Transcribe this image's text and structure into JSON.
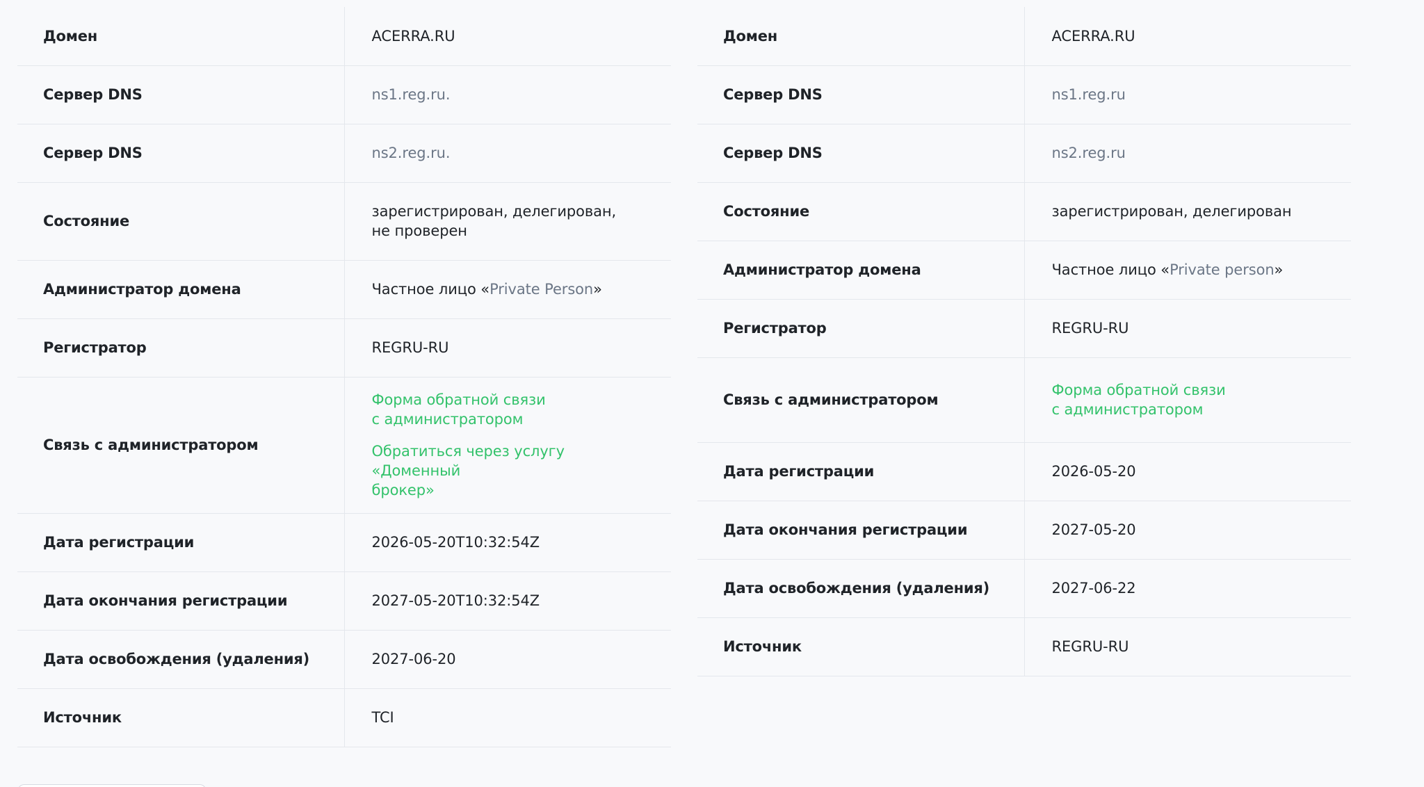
{
  "left": {
    "rows": [
      {
        "key": "Домен",
        "value": "ACERRA.RU"
      },
      {
        "key": "Сервер DNS",
        "value": "ns1.reg.ru."
      },
      {
        "key": "Сервер DNS",
        "value": "ns2.reg.ru."
      },
      {
        "key": "Состояние",
        "value": "зарегистрирован, делегирован,\nне проверен"
      },
      {
        "key": "Администратор домена",
        "value_prefix": "Частное лицо «",
        "value_link": "Private Person",
        "value_suffix": "»"
      },
      {
        "key": "Регистратор",
        "value": "REGRU-RU"
      },
      {
        "key": "Связь с администратором",
        "link1": "Форма обратной связи\nс администратором",
        "link2": "Обратиться через услугу «Доменный\nброкер»"
      },
      {
        "key": "Дата регистрации",
        "value": "2026-05-20T10:32:54Z"
      },
      {
        "key": "Дата окончания регистрации",
        "value": "2027-05-20T10:32:54Z"
      },
      {
        "key": "Дата освобождения (удаления)",
        "value": "2027-06-20"
      },
      {
        "key": "Источник",
        "value": "TCI"
      }
    ]
  },
  "right": {
    "rows": [
      {
        "key": "Домен",
        "value": "ACERRA.RU"
      },
      {
        "key": "Сервер DNS",
        "value": "ns1.reg.ru"
      },
      {
        "key": "Сервер DNS",
        "value": "ns2.reg.ru"
      },
      {
        "key": "Состояние",
        "value": "зарегистрирован, делегирован"
      },
      {
        "key": "Администратор домена",
        "value_prefix": "Частное лицо «",
        "value_link": "Private person",
        "value_suffix": "»"
      },
      {
        "key": "Регистратор",
        "value": "REGRU-RU"
      },
      {
        "key": "Связь с администратором",
        "link1": "Форма обратной связи\nс администратором"
      },
      {
        "key": "Дата регистрации",
        "value": "2026-05-20"
      },
      {
        "key": "Дата окончания регистрации",
        "value": "2027-05-20"
      },
      {
        "key": "Дата освобождения (удаления)",
        "value": "2027-06-22"
      },
      {
        "key": "Источник",
        "value": "REGRU-RU"
      }
    ]
  },
  "colors": {
    "link": "#33c26b",
    "muted": "#6b7686",
    "text": "#1f2328",
    "border": "#e4e7ec",
    "background": "#f8f9fb"
  }
}
